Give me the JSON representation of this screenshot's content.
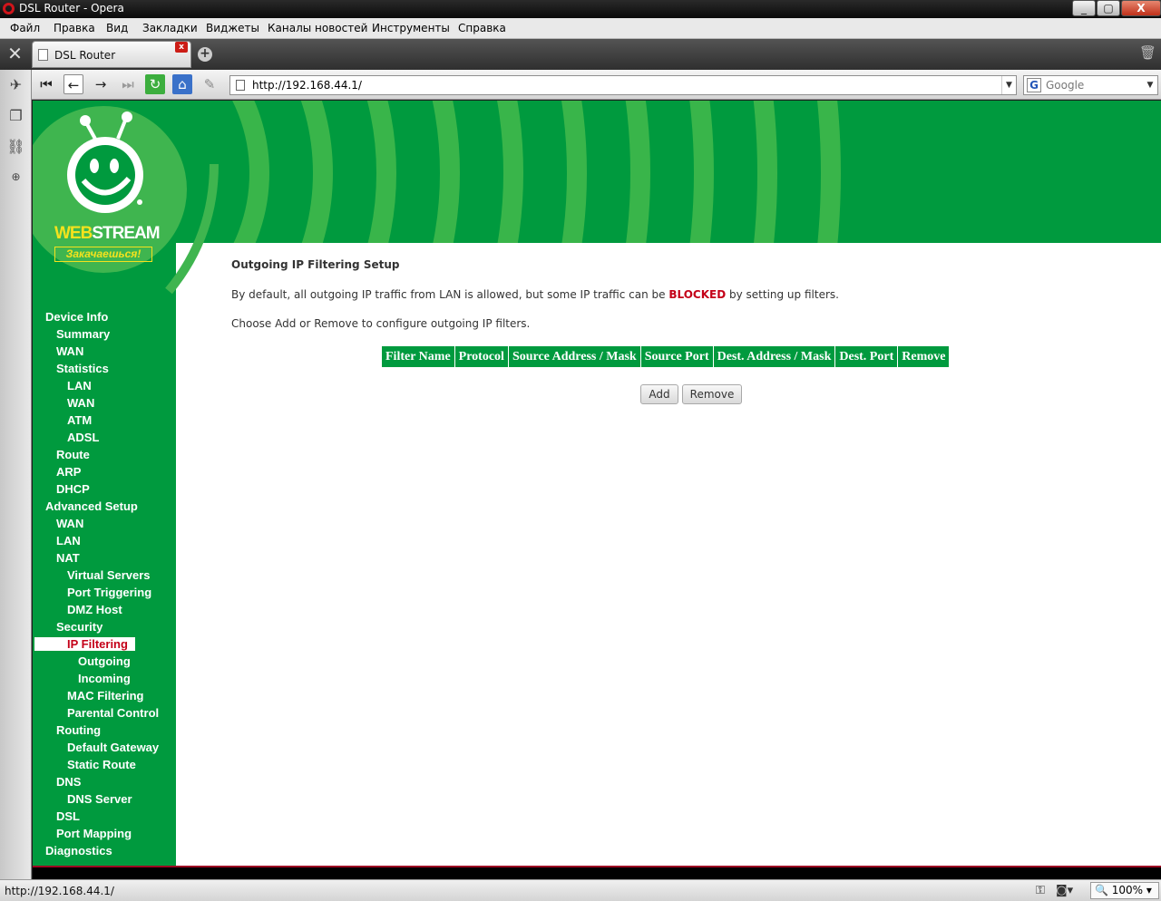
{
  "window": {
    "title": "DSL Router - Opera",
    "controls": [
      "_",
      "▢",
      "X"
    ]
  },
  "menubar": [
    "Файл",
    "Правка",
    "Вид",
    "Закладки",
    "Виджеты",
    "Каналы новостей",
    "Инструменты",
    "Справка"
  ],
  "tab": {
    "title": "DSL Router",
    "close": "x",
    "new_tab": "+"
  },
  "nav": {
    "url": "http://192.168.44.1/",
    "search_placeholder": "Google",
    "search_icon": "G",
    "dropdown": "▼"
  },
  "logo": {
    "web": "WEB",
    "stream": "STREAM",
    "slogan": "Закачаешься!"
  },
  "sidebar_menu": [
    {
      "label": "Device Info",
      "level": 0
    },
    {
      "label": "Summary",
      "level": 1
    },
    {
      "label": "WAN",
      "level": 1
    },
    {
      "label": "Statistics",
      "level": 1
    },
    {
      "label": "LAN",
      "level": 2
    },
    {
      "label": "WAN",
      "level": 2
    },
    {
      "label": "ATM",
      "level": 2
    },
    {
      "label": "ADSL",
      "level": 2
    },
    {
      "label": "Route",
      "level": 1
    },
    {
      "label": "ARP",
      "level": 1
    },
    {
      "label": "DHCP",
      "level": 1
    },
    {
      "label": "Advanced Setup",
      "level": 0
    },
    {
      "label": "WAN",
      "level": 1
    },
    {
      "label": "LAN",
      "level": 1
    },
    {
      "label": "NAT",
      "level": 1
    },
    {
      "label": "Virtual Servers",
      "level": 2
    },
    {
      "label": "Port Triggering",
      "level": 2
    },
    {
      "label": "DMZ Host",
      "level": 2
    },
    {
      "label": "Security",
      "level": 1
    },
    {
      "label": "IP Filtering",
      "level": 2,
      "active": true
    },
    {
      "label": "Outgoing",
      "level": 3
    },
    {
      "label": "Incoming",
      "level": 3
    },
    {
      "label": "MAC Filtering",
      "level": 2
    },
    {
      "label": "Parental Control",
      "level": 2
    },
    {
      "label": "Routing",
      "level": 1
    },
    {
      "label": "Default Gateway",
      "level": 2
    },
    {
      "label": "Static Route",
      "level": 2
    },
    {
      "label": "DNS",
      "level": 1
    },
    {
      "label": "DNS Server",
      "level": 2
    },
    {
      "label": "DSL",
      "level": 1
    },
    {
      "label": "Port Mapping",
      "level": 1
    },
    {
      "label": "Diagnostics",
      "level": 0
    }
  ],
  "main": {
    "heading": "Outgoing IP Filtering Setup",
    "intro_before": "By default, all outgoing IP traffic from LAN is allowed, but some IP traffic can be ",
    "intro_blocked": "BLOCKED",
    "intro_after": " by setting up filters.",
    "instruction": "Choose Add or Remove to configure outgoing IP filters.",
    "table_headers": [
      "Filter Name",
      "Protocol",
      "Source Address / Mask",
      "Source Port",
      "Dest. Address / Mask",
      "Dest. Port",
      "Remove"
    ],
    "add_label": "Add",
    "remove_label": "Remove"
  },
  "status": {
    "url": "http://192.168.44.1/",
    "zoom": "100%"
  },
  "colors": {
    "brand_green": "#009a3e",
    "logo_yellow": "#f4e21d",
    "alert_red": "#c40018"
  }
}
